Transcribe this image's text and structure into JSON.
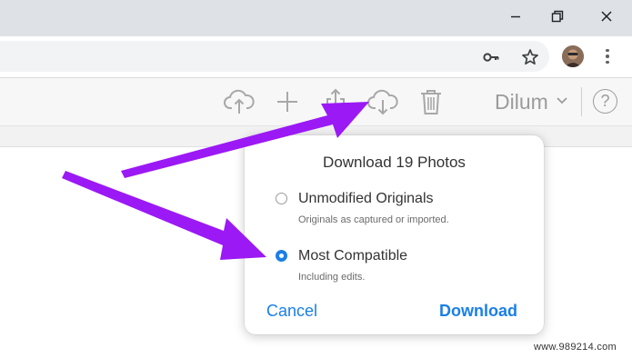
{
  "window_controls": {
    "minimize_icon": "minimize-icon",
    "restore_icon": "restore-icon",
    "close_icon": "close-icon"
  },
  "address_bar": {
    "icons": [
      "key-icon",
      "star-icon"
    ],
    "profile": "avatar",
    "menu": "more-vert-icon"
  },
  "toolbar": {
    "icons": [
      "upload-cloud-icon",
      "plus-icon",
      "share-icon",
      "download-cloud-icon",
      "trash-icon"
    ],
    "user_name": "Dilum",
    "help_label": "?"
  },
  "download_popover": {
    "title": "Download 19 Photos",
    "options": [
      {
        "label": "Unmodified Originals",
        "description": "Originals as captured or imported.",
        "selected": false
      },
      {
        "label": "Most Compatible",
        "description": "Including edits.",
        "selected": true
      }
    ],
    "cancel_label": "Cancel",
    "download_label": "Download"
  },
  "colors": {
    "accent": "#1a7fe8",
    "arrow": "#9b19f5",
    "icon_gray": "#a8a8a8"
  },
  "watermark": "www.989214.com"
}
